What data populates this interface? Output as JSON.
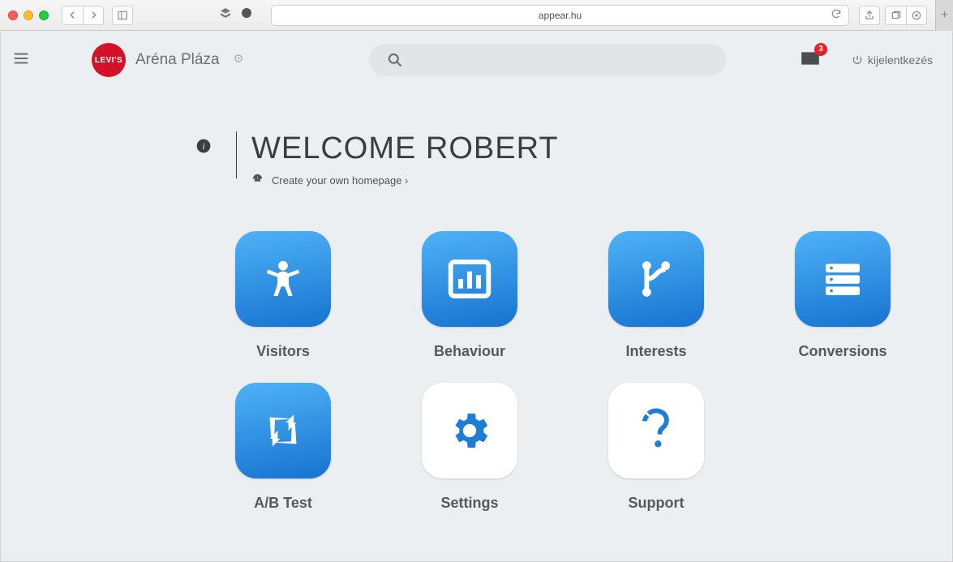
{
  "browser": {
    "url_display": "appear.hu"
  },
  "topbar": {
    "logo_text": "LEVI'S",
    "brand_name": "Aréna Pláza",
    "notification_count": "3",
    "logout_label": "kijelentkezés"
  },
  "welcome": {
    "title": "WELCOME ROBERT",
    "sub_link": "Create your own homepage ›"
  },
  "tiles": [
    {
      "label": "Visitors"
    },
    {
      "label": "Behaviour"
    },
    {
      "label": "Interests"
    },
    {
      "label": "Conversions"
    },
    {
      "label": "A/B Test"
    },
    {
      "label": "Settings"
    },
    {
      "label": "Support"
    }
  ]
}
